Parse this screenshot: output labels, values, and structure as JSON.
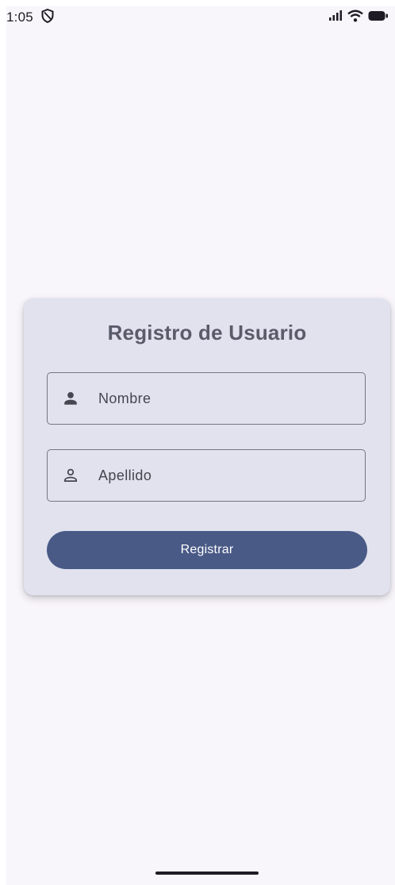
{
  "status_bar": {
    "time": "1:05",
    "left_icon": "shield-outline-icon",
    "right_icons": [
      "signal-icon",
      "wifi-icon",
      "battery-icon"
    ]
  },
  "form": {
    "title": "Registro de Usuario",
    "nombre_placeholder": "Nombre",
    "nombre_icon": "person-filled-icon",
    "apellido_placeholder": "Apellido",
    "apellido_icon": "person-outline-icon",
    "submit_label": "Registrar"
  },
  "colors": {
    "background": "#f8f5fb",
    "card": "#e1e2ee",
    "primary": "#4a5a87",
    "title_text": "#5b5c6a",
    "field_border": "#74757f"
  }
}
